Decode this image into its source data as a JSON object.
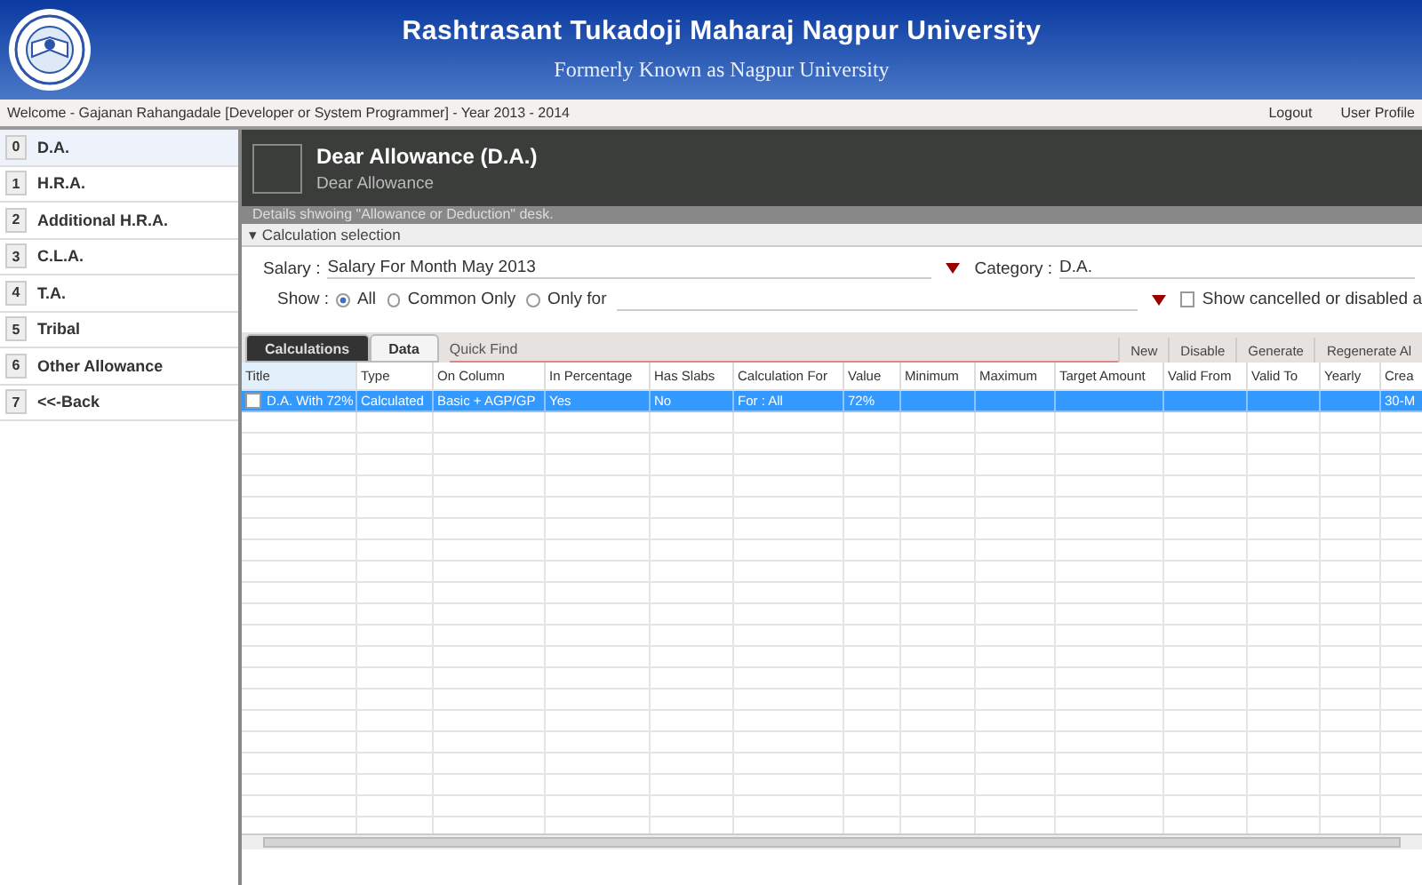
{
  "header": {
    "title": "Rashtrasant Tukadoji Maharaj Nagpur University",
    "subtitle": "Formerly Known as Nagpur University"
  },
  "welcome_bar": {
    "text": "Welcome - Gajanan Rahangadale [Developer or System Programmer] - Year 2013 - 2014",
    "links": [
      "Logout",
      "User Profile"
    ]
  },
  "sidebar": {
    "items": [
      {
        "key": "0",
        "label": "D.A.",
        "selected": true
      },
      {
        "key": "1",
        "label": "H.R.A.",
        "selected": false
      },
      {
        "key": "2",
        "label": "Additional H.R.A.",
        "selected": false
      },
      {
        "key": "3",
        "label": "C.L.A.",
        "selected": false
      },
      {
        "key": "4",
        "label": "T.A.",
        "selected": false
      },
      {
        "key": "5",
        "label": "Tribal",
        "selected": false
      },
      {
        "key": "6",
        "label": "Other Allowance",
        "selected": false
      },
      {
        "key": "7",
        "label": "<<-Back",
        "selected": false
      }
    ]
  },
  "panel": {
    "title": "Dear Allowance (D.A.)",
    "subtitle": "Dear Allowance",
    "details": "Details shwoing \"Allowance or Deduction\" desk.",
    "section": "▾ Calculation selection",
    "salary_label": "Salary :",
    "salary_value": "Salary For Month May 2013",
    "category_label": "Category :",
    "category_value": "D.A.",
    "show_label": "Show :",
    "show_options": [
      {
        "label": "All",
        "selected": true
      },
      {
        "label": "Common Only",
        "selected": false
      },
      {
        "label": "Only for",
        "selected": false
      }
    ],
    "show_cancelled": {
      "label": "Show cancelled or disabled a",
      "checked": false
    }
  },
  "tabs": [
    {
      "label": "Calculations",
      "selected": true
    },
    {
      "label": "Data",
      "selected": false
    }
  ],
  "quick_find": {
    "placeholder": "Quick Find"
  },
  "toolbar": [
    "New",
    "Disable",
    "Generate",
    "Regenerate Al"
  ],
  "table": {
    "columns": [
      "Title",
      "Type",
      "On Column",
      "In Percentage",
      "Has Slabs",
      "Calculation For",
      "Value",
      "Minimum",
      "Maximum",
      "Target Amount",
      "Valid From",
      "Valid To",
      "Yearly",
      "Crea"
    ],
    "rows": [
      {
        "checked": false,
        "selected": true,
        "cells": [
          "D.A. With 72%",
          "Calculated",
          "Basic + AGP/GP",
          "Yes",
          "No",
          "For : All",
          "72%",
          "",
          "",
          "",
          "",
          "",
          "",
          "30-M"
        ]
      }
    ]
  }
}
